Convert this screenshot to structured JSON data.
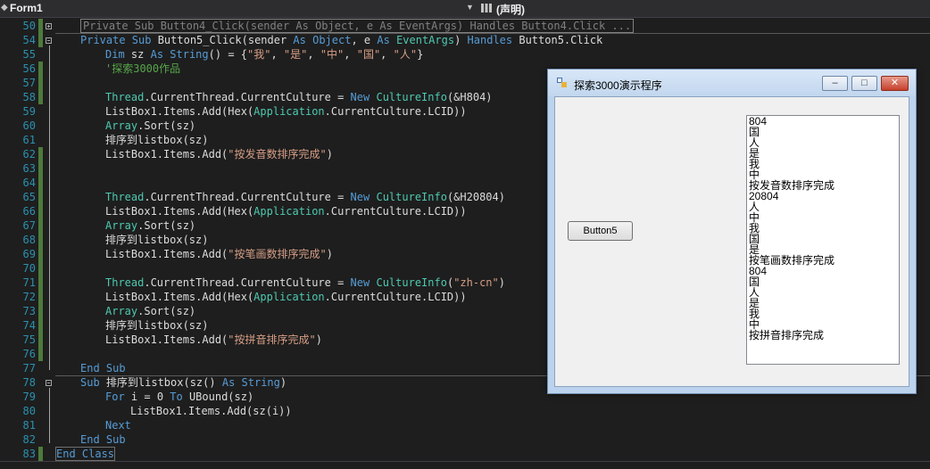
{
  "top_nav": {
    "form_combo": "Form1",
    "member_combo": "(声明)"
  },
  "editor": {
    "lines": [
      {
        "num": "50",
        "saved": true
      },
      {
        "num": "54",
        "saved": true
      },
      {
        "num": "55",
        "saved": false
      },
      {
        "num": "56",
        "saved": true
      },
      {
        "num": "57",
        "saved": true
      },
      {
        "num": "58",
        "saved": true
      },
      {
        "num": "59",
        "saved": false
      },
      {
        "num": "60",
        "saved": false
      },
      {
        "num": "61",
        "saved": false
      },
      {
        "num": "62",
        "saved": true
      },
      {
        "num": "63",
        "saved": true
      },
      {
        "num": "64",
        "saved": true
      },
      {
        "num": "65",
        "saved": true
      },
      {
        "num": "66",
        "saved": true
      },
      {
        "num": "67",
        "saved": true
      },
      {
        "num": "68",
        "saved": true
      },
      {
        "num": "69",
        "saved": true
      },
      {
        "num": "70",
        "saved": true
      },
      {
        "num": "71",
        "saved": true
      },
      {
        "num": "72",
        "saved": true
      },
      {
        "num": "73",
        "saved": true
      },
      {
        "num": "74",
        "saved": true
      },
      {
        "num": "75",
        "saved": true
      },
      {
        "num": "76",
        "saved": true
      },
      {
        "num": "77",
        "saved": false
      },
      {
        "num": "78",
        "saved": false
      },
      {
        "num": "79",
        "saved": false
      },
      {
        "num": "80",
        "saved": false
      },
      {
        "num": "81",
        "saved": false
      },
      {
        "num": "82",
        "saved": false
      },
      {
        "num": "83",
        "saved": true
      }
    ],
    "code": {
      "l50": "Private Sub Button4_Click(sender As Object, e As EventArgs) Handles Button4.Click ...",
      "l54": {
        "a": "Private Sub ",
        "b": "Button5_Click(sender ",
        "c": "As",
        "d": " ",
        "e": "Object",
        "f": ", e ",
        "g": "As",
        "h": " ",
        "i": "EventArgs",
        "j": ") ",
        "k": "Handles",
        "l": " Button5.Click"
      },
      "l55": {
        "a": "Dim",
        "b": " sz ",
        "c": "As",
        "d": " ",
        "e": "String",
        "f": "() = {",
        "g": "\"我\"",
        "h": ", ",
        "i": "\"是\"",
        "j": ", ",
        "k": "\"中\"",
        "l": ", ",
        "m": "\"国\"",
        "n": ", ",
        "o": "\"人\"",
        "p": "}"
      },
      "l56": "'探索3000作品",
      "l58": {
        "a": "Thread",
        "b": ".CurrentThread.CurrentCulture = ",
        "c": "New",
        "d": " ",
        "e": "CultureInfo",
        "f": "(&H804)"
      },
      "l59": {
        "a": "ListBox1.Items.Add(Hex(",
        "b": "Application",
        "c": ".CurrentCulture.LCID))"
      },
      "l60": {
        "a": "Array",
        "b": ".Sort(sz)"
      },
      "l61": "排序到listbox(sz)",
      "l62": {
        "a": "ListBox1.Items.Add(",
        "b": "\"按发音数排序完成\"",
        "c": ")"
      },
      "l65": {
        "a": "Thread",
        "b": ".CurrentThread.CurrentCulture = ",
        "c": "New",
        "d": " ",
        "e": "CultureInfo",
        "f": "(&H20804)"
      },
      "l66": {
        "a": "ListBox1.Items.Add(Hex(",
        "b": "Application",
        "c": ".CurrentCulture.LCID))"
      },
      "l67": {
        "a": "Array",
        "b": ".Sort(sz)"
      },
      "l68": "排序到listbox(sz)",
      "l69": {
        "a": "ListBox1.Items.Add(",
        "b": "\"按笔画数排序完成\"",
        "c": ")"
      },
      "l71": {
        "a": "Thread",
        "b": ".CurrentThread.CurrentCulture = ",
        "c": "New",
        "d": " ",
        "e": "CultureInfo",
        "f": "(",
        "g": "\"zh-cn\"",
        "h": ")"
      },
      "l72": {
        "a": "ListBox1.Items.Add(Hex(",
        "b": "Application",
        "c": ".CurrentCulture.LCID))"
      },
      "l73": {
        "a": "Array",
        "b": ".Sort(sz)"
      },
      "l74": "排序到listbox(sz)",
      "l75": {
        "a": "ListBox1.Items.Add(",
        "b": "\"按拼音排序完成\"",
        "c": ")"
      },
      "l77": "End Sub",
      "l78": {
        "a": "Sub",
        "b": " 排序到listbox(sz() ",
        "c": "As",
        "d": " ",
        "e": "String",
        "f": ")"
      },
      "l79": {
        "a": "For",
        "b": " i = ",
        "c": "0",
        "d": " ",
        "e": "To",
        "f": " UBound(sz)"
      },
      "l80": "ListBox1.Items.Add(sz(i))",
      "l81": "Next",
      "l82": "End Sub",
      "l83": "End Class"
    }
  },
  "form_window": {
    "title": "探索3000演示程序",
    "minimize_glyph": "–",
    "maximize_glyph": "□",
    "close_glyph": "✕",
    "button5_label": "Button5",
    "listbox_items": [
      "804",
      "国",
      "人",
      "是",
      "我",
      "中",
      "按发音数排序完成",
      "20804",
      "人",
      "中",
      "我",
      "国",
      "是",
      "按笔画数排序完成",
      "804",
      "国",
      "人",
      "是",
      "我",
      "中",
      "按拼音排序完成"
    ]
  }
}
